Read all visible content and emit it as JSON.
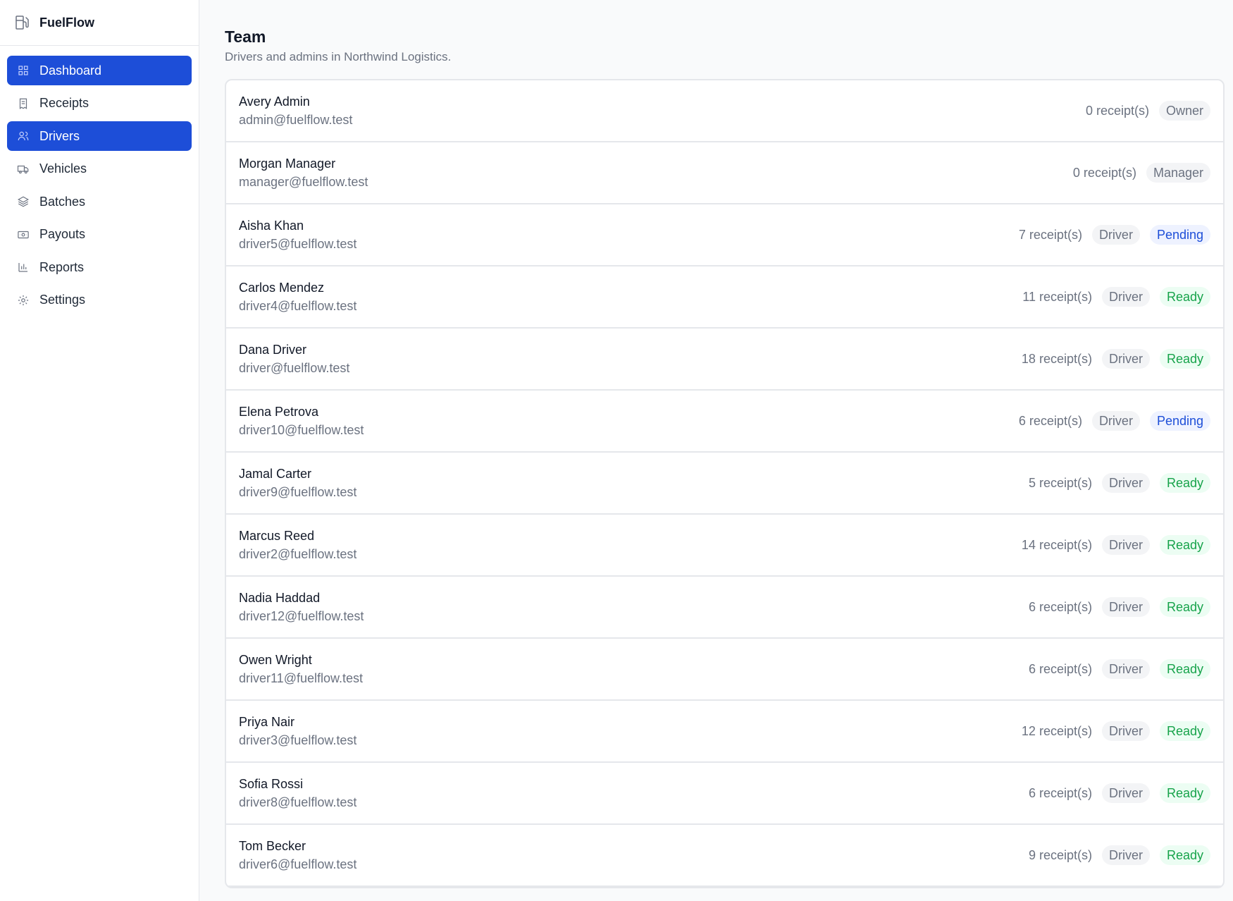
{
  "app": {
    "name": "FuelFlow"
  },
  "sidebar": {
    "items": [
      {
        "label": "Dashboard",
        "icon": "grid-icon",
        "active": true
      },
      {
        "label": "Receipts",
        "icon": "receipt-icon",
        "active": false
      },
      {
        "label": "Drivers",
        "icon": "users-icon",
        "active": true
      },
      {
        "label": "Vehicles",
        "icon": "truck-icon",
        "active": false
      },
      {
        "label": "Batches",
        "icon": "layers-icon",
        "active": false
      },
      {
        "label": "Payouts",
        "icon": "banknote-icon",
        "active": false
      },
      {
        "label": "Reports",
        "icon": "bar-chart-icon",
        "active": false
      },
      {
        "label": "Settings",
        "icon": "gear-icon",
        "active": false
      }
    ]
  },
  "page": {
    "title": "Team",
    "subtitle": "Drivers and admins in Northwind Logistics."
  },
  "colors": {
    "accent": "#1d4ed8",
    "ready": "#16a34a",
    "pending": "#1d4ed8"
  },
  "team": [
    {
      "name": "Avery Admin",
      "email": "admin@fuelflow.test",
      "receipts": "0 receipt(s)",
      "role": "Owner",
      "status": ""
    },
    {
      "name": "Morgan Manager",
      "email": "manager@fuelflow.test",
      "receipts": "0 receipt(s)",
      "role": "Manager",
      "status": ""
    },
    {
      "name": "Aisha Khan",
      "email": "driver5@fuelflow.test",
      "receipts": "7 receipt(s)",
      "role": "Driver",
      "status": "Pending"
    },
    {
      "name": "Carlos Mendez",
      "email": "driver4@fuelflow.test",
      "receipts": "11 receipt(s)",
      "role": "Driver",
      "status": "Ready"
    },
    {
      "name": "Dana Driver",
      "email": "driver@fuelflow.test",
      "receipts": "18 receipt(s)",
      "role": "Driver",
      "status": "Ready"
    },
    {
      "name": "Elena Petrova",
      "email": "driver10@fuelflow.test",
      "receipts": "6 receipt(s)",
      "role": "Driver",
      "status": "Pending"
    },
    {
      "name": "Jamal Carter",
      "email": "driver9@fuelflow.test",
      "receipts": "5 receipt(s)",
      "role": "Driver",
      "status": "Ready"
    },
    {
      "name": "Marcus Reed",
      "email": "driver2@fuelflow.test",
      "receipts": "14 receipt(s)",
      "role": "Driver",
      "status": "Ready"
    },
    {
      "name": "Nadia Haddad",
      "email": "driver12@fuelflow.test",
      "receipts": "6 receipt(s)",
      "role": "Driver",
      "status": "Ready"
    },
    {
      "name": "Owen Wright",
      "email": "driver11@fuelflow.test",
      "receipts": "6 receipt(s)",
      "role": "Driver",
      "status": "Ready"
    },
    {
      "name": "Priya Nair",
      "email": "driver3@fuelflow.test",
      "receipts": "12 receipt(s)",
      "role": "Driver",
      "status": "Ready"
    },
    {
      "name": "Sofia Rossi",
      "email": "driver8@fuelflow.test",
      "receipts": "6 receipt(s)",
      "role": "Driver",
      "status": "Ready"
    },
    {
      "name": "Tom Becker",
      "email": "driver6@fuelflow.test",
      "receipts": "9 receipt(s)",
      "role": "Driver",
      "status": "Ready"
    }
  ]
}
